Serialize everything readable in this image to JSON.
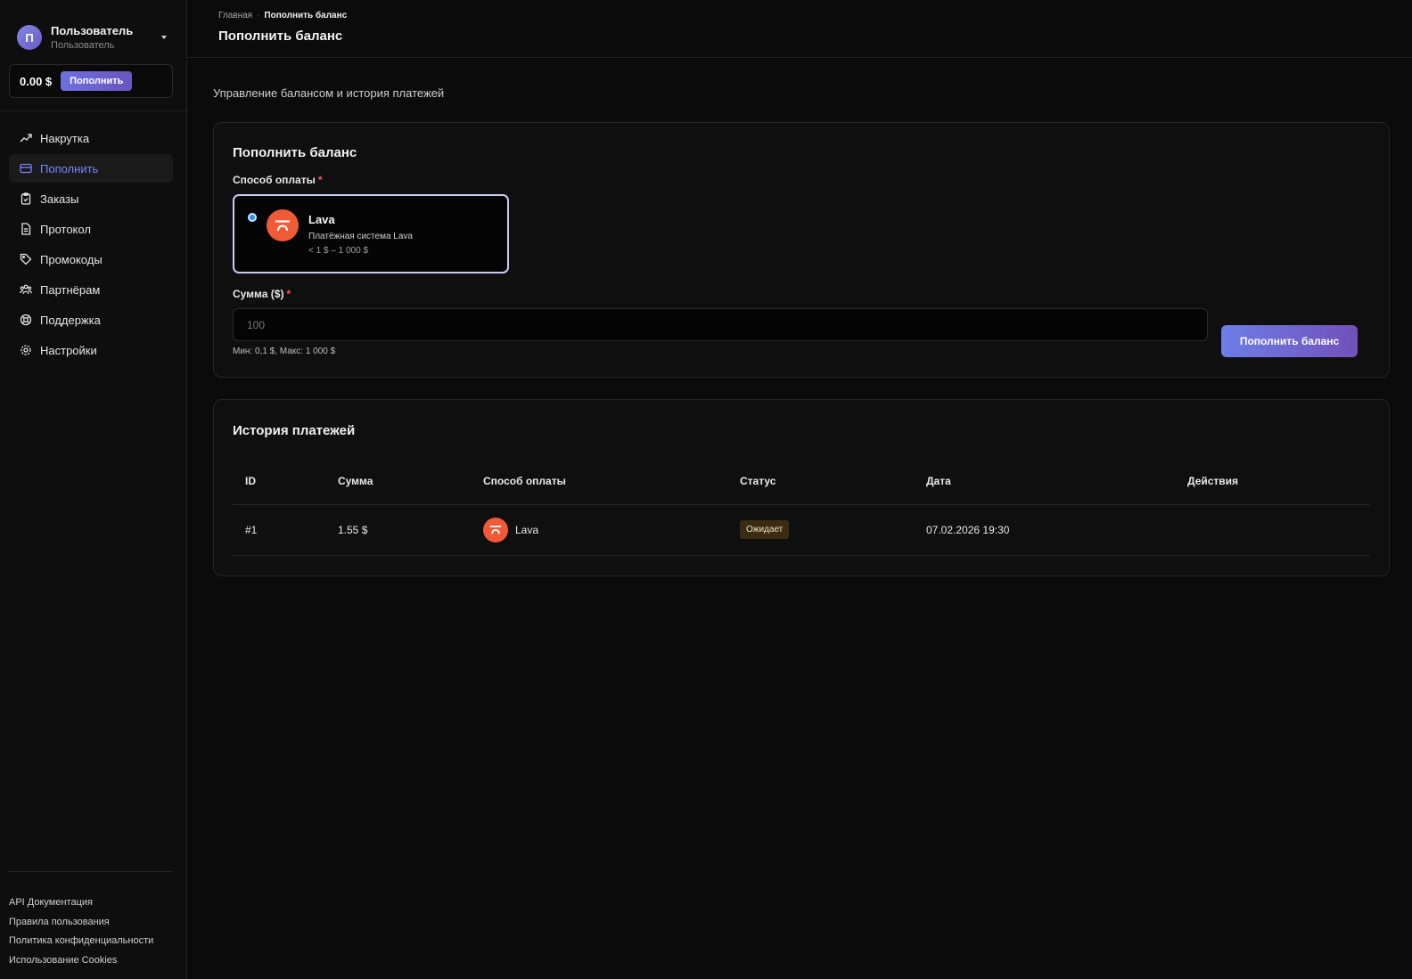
{
  "user": {
    "initial": "П",
    "name": "Пользователь",
    "role": "Пользователь"
  },
  "balance": {
    "amount": "0.00 $",
    "topup_label": "Пополнить"
  },
  "nav": [
    {
      "label": "Накрутка",
      "icon": "trending-up-icon",
      "active": false
    },
    {
      "label": "Пополнить",
      "icon": "credit-card-icon",
      "active": true
    },
    {
      "label": "Заказы",
      "icon": "clipboard-icon",
      "active": false
    },
    {
      "label": "Протокол",
      "icon": "document-icon",
      "active": false
    },
    {
      "label": "Промокоды",
      "icon": "tag-icon",
      "active": false
    },
    {
      "label": "Партнёрам",
      "icon": "users-icon",
      "active": false
    },
    {
      "label": "Поддержка",
      "icon": "lifebuoy-icon",
      "active": false
    },
    {
      "label": "Настройки",
      "icon": "gear-icon",
      "active": false
    }
  ],
  "footer_links": [
    "API Документация",
    "Правила пользования",
    "Политика конфиденциальности",
    "Использование Cookies"
  ],
  "header": {
    "breadcrumb": {
      "home": "Главная",
      "separator": "·",
      "current": "Пополнить баланс"
    },
    "title": "Пополнить баланс"
  },
  "main": {
    "subtitle": "Управление балансом и история платежей",
    "topup": {
      "title": "Пополнить баланс",
      "method_label": "Способ оплаты",
      "required_mark": "*",
      "method": {
        "name": "Lava",
        "description": "Платёжная система Lava",
        "range": "< 1 $ – 1 000 $",
        "selected": true
      },
      "amount_label": "Сумма ($)",
      "amount_placeholder": "100",
      "amount_value": "",
      "amount_hint": "Мин: 0,1 $, Макс: 1 000 $",
      "submit_label": "Пополнить баланс"
    },
    "history": {
      "title": "История платежей",
      "columns": [
        "ID",
        "Сумма",
        "Способ оплаты",
        "Статус",
        "Дата",
        "Действия"
      ],
      "rows": [
        {
          "id": "#1",
          "amount": "1.55 $",
          "method": "Lava",
          "status": "Ожидает",
          "date": "07.02.2026 19:30",
          "actions": ""
        }
      ]
    }
  },
  "colors": {
    "accent": "#7a84ff",
    "lava": "#f15a37",
    "pending_bg": "#3a2c12"
  }
}
